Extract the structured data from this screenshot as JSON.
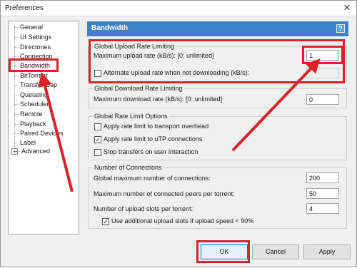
{
  "window": {
    "title": "Preferences"
  },
  "sidebar": {
    "items": [
      {
        "label": "General"
      },
      {
        "label": "UI Settings"
      },
      {
        "label": "Directories"
      },
      {
        "label": "Connection"
      },
      {
        "label": "Bandwidth"
      },
      {
        "label": "BitTorrent"
      },
      {
        "label": "Transfer Cap"
      },
      {
        "label": "Queueing"
      },
      {
        "label": "Scheduler"
      },
      {
        "label": "Remote"
      },
      {
        "label": "Playback"
      },
      {
        "label": "Paired Devices"
      },
      {
        "label": "Label"
      },
      {
        "label": "Advanced"
      }
    ]
  },
  "panel": {
    "title": "Bandwidth",
    "help": "?"
  },
  "upload_group": {
    "title": "Global Upload Rate Limiting",
    "max_rate_label": "Maximum upload rate (kB/s): [0: unlimited]",
    "max_rate_value": "1",
    "alt_label": "Alternate upload rate when not downloading (kB/s):",
    "alt_value": ""
  },
  "download_group": {
    "title": "Global Download Rate Limiting",
    "max_rate_label": "Maximum download rate (kB/s): [0: unlimited]",
    "max_rate_value": "0"
  },
  "options_group": {
    "title": "Global Rate Limit Options",
    "transport": "Apply rate limit to transport overhead",
    "utp": "Apply rate limit to uTP connections",
    "stop": "Stop transfers on user interaction"
  },
  "connections_group": {
    "title": "Number of Connections",
    "global_label": "Global maximum number of connections:",
    "global_value": "200",
    "peers_label": "Maximum number of connected peers per torrent:",
    "peers_value": "50",
    "slots_label": "Number of upload slots per torrent:",
    "slots_value": "4",
    "extra_slots": "Use additional upload slots if upload speed < 90%"
  },
  "buttons": {
    "ok": "OK",
    "cancel": "Cancel",
    "apply": "Apply"
  },
  "colors": {
    "header": "#3d82c9",
    "highlight": "#d9232a"
  }
}
